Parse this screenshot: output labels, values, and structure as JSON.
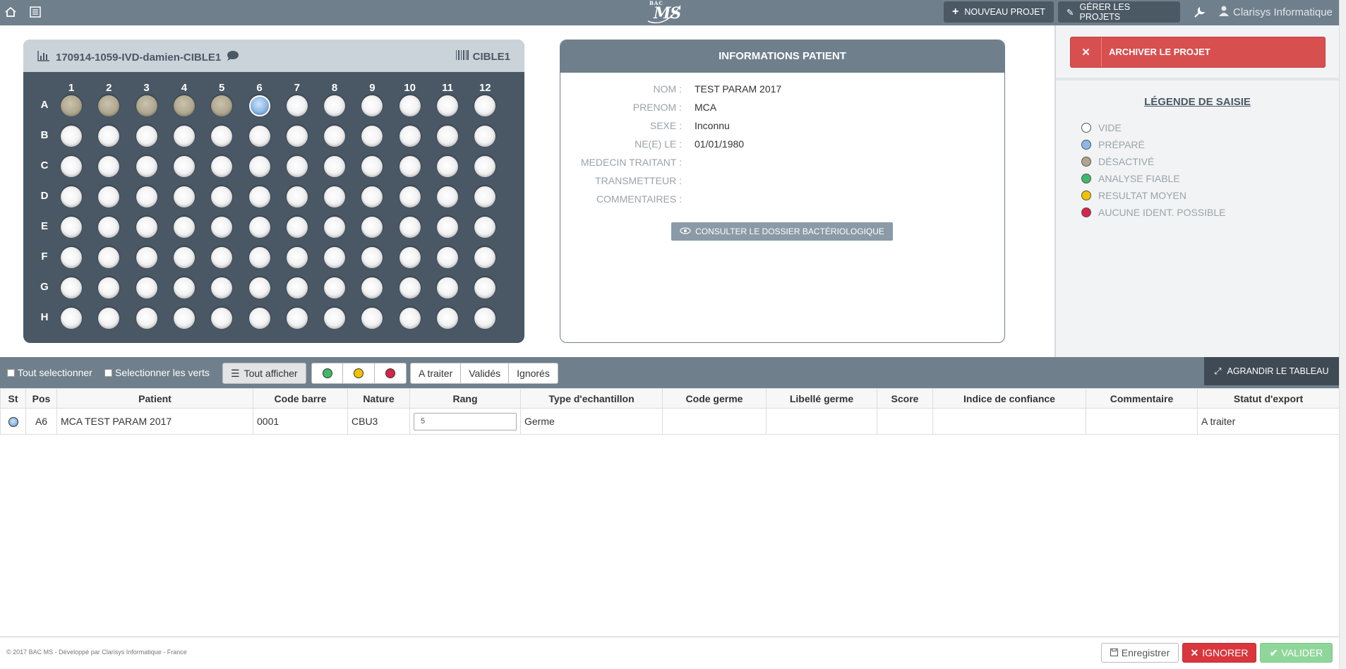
{
  "nav": {
    "home_icon": "home-icon",
    "menu_icon": "list-icon",
    "logo_small": "BAC",
    "logo_big": "MS",
    "new_project": "NOUVEAU PROJET",
    "manage_projects": "GÉRER LES PROJETS",
    "tools_icon": "wrench-icon",
    "user": "Clarisys Informatique"
  },
  "plate": {
    "title": "170914-1059-IVD-damien-CIBLE1",
    "tag": "CIBLE1",
    "columns": [
      "1",
      "2",
      "3",
      "4",
      "5",
      "6",
      "7",
      "8",
      "9",
      "10",
      "11",
      "12"
    ],
    "rows": [
      "A",
      "B",
      "C",
      "D",
      "E",
      "F",
      "G",
      "H"
    ],
    "well_states": {
      "A1": "disabled",
      "A2": "disabled",
      "A3": "disabled",
      "A4": "disabled",
      "A5": "disabled",
      "A6": "prepared"
    }
  },
  "patient": {
    "header": "INFORMATIONS PATIENT",
    "fields": [
      {
        "label": "NOM :",
        "value": "TEST PARAM 2017"
      },
      {
        "label": "PRENOM :",
        "value": "MCA"
      },
      {
        "label": "SEXE :",
        "value": "Inconnu"
      },
      {
        "label": "NE(E) LE :",
        "value": "01/01/1980"
      },
      {
        "label": "MEDECIN TRAITANT :",
        "value": ""
      },
      {
        "label": "TRANSMETTEUR :",
        "value": ""
      },
      {
        "label": "COMMENTAIRES :",
        "value": ""
      }
    ],
    "consult_button": "CONSULTER LE DOSSIER BACTÉRIOLOGIQUE"
  },
  "sidebar": {
    "archive": "ARCHIVER LE PROJET",
    "legend_title": "LÉGENDE DE SAISIE",
    "legend": [
      {
        "label": "VIDE",
        "color": "#ffffff"
      },
      {
        "label": "PRÉPARÉ",
        "color": "#8bb8e8"
      },
      {
        "label": "DÉSACTIVÉ",
        "color": "#aea58c"
      },
      {
        "label": "ANALYSE FIABLE",
        "color": "#3fb86a"
      },
      {
        "label": "RESULTAT MOYEN",
        "color": "#f2c200"
      },
      {
        "label": "AUCUNE IDENT. POSSIBLE",
        "color": "#d6234a"
      }
    ]
  },
  "filters": {
    "select_all": "Tout selectionner",
    "select_green": "Selectionner les verts",
    "show_all": "Tout afficher",
    "status_colors": [
      "#3fb86a",
      "#f2c200",
      "#d6234a"
    ],
    "to_process": "A traiter",
    "validated": "Validés",
    "ignored": "Ignorés",
    "enlarge": "AGRANDIR LE TABLEAU"
  },
  "table": {
    "headers": [
      "St",
      "Pos",
      "Patient",
      "Code barre",
      "Nature",
      "Rang",
      "Type d'echantillon",
      "Code germe",
      "Libellé germe",
      "Score",
      "Indice de confiance",
      "Commentaire",
      "Statut d'export"
    ],
    "rows": [
      {
        "pos": "A6",
        "patient": "MCA TEST PARAM 2017",
        "code_barre": "0001",
        "nature": "CBU3",
        "rang": "5",
        "type": "Germe",
        "code_germe": "",
        "libelle": "",
        "score": "",
        "indice": "",
        "commentaire": "",
        "statut": "A traiter"
      }
    ]
  },
  "footer": {
    "copyright": "© 2017 BAC MS - Développé par Clarisys Informatique - France",
    "save": "Enregistrer",
    "ignore": "IGNORER",
    "validate": "VALIDER"
  }
}
